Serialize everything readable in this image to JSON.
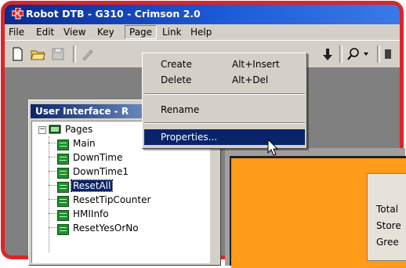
{
  "window": {
    "title": "Robot DTB - G310 - Crimson 2.0",
    "titlebar_color": "#0a246a",
    "frame_color": "#e0262a"
  },
  "menubar": {
    "items": [
      "File",
      "Edit",
      "View",
      "Key",
      "Page",
      "Link",
      "Help"
    ],
    "active": "Page"
  },
  "page_menu": {
    "items": [
      {
        "label": "Create",
        "shortcut": "Alt+Insert"
      },
      {
        "label": "Delete",
        "shortcut": "Alt+Del"
      },
      {
        "label": "Rename",
        "shortcut": ""
      },
      {
        "label": "Properties...",
        "shortcut": "",
        "highlighted": true
      }
    ]
  },
  "panel": {
    "title": "User Interface - R"
  },
  "tree": {
    "root": "Pages",
    "pages": [
      "Main",
      "DownTime",
      "DownTime1",
      "ResetAll",
      "ResetTipCounter",
      "HMIInfo",
      "ResetYesOrNo"
    ],
    "selected": "ResetAll"
  },
  "design_area": {
    "lines": [
      "Total",
      "Store",
      "Gree"
    ],
    "background_color": "#ff9a1a"
  }
}
